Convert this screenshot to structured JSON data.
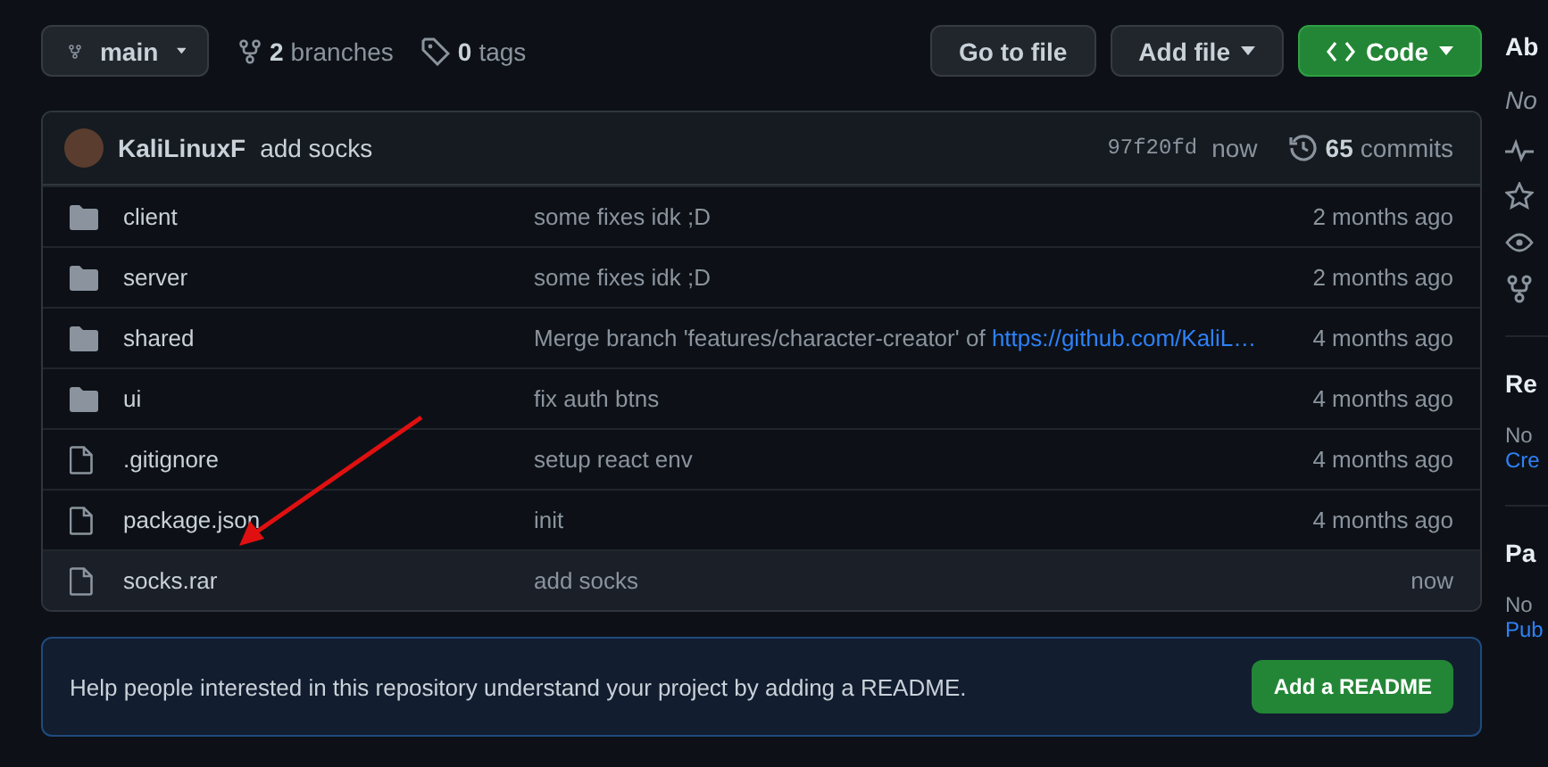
{
  "toolbar": {
    "branch": "main",
    "branches": {
      "count": "2",
      "label": "branches"
    },
    "tags": {
      "count": "0",
      "label": "tags"
    },
    "buttons": [
      {
        "label": "Go to file",
        "kind": "plain",
        "dropdown": false
      },
      {
        "label": "Add file",
        "kind": "plain",
        "dropdown": true
      },
      {
        "label": "Code",
        "kind": "primary",
        "dropdown": true
      }
    ]
  },
  "latest_commit": {
    "author": "KaliLinuxF",
    "message": "add socks",
    "sha": "97f20fd",
    "time": "now",
    "commits": {
      "count": "65",
      "label": "commits"
    }
  },
  "files": [
    {
      "kind": "folder",
      "name": "client",
      "message": "some fixes idk ;D",
      "time": "2 months ago",
      "highlighted": false
    },
    {
      "kind": "folder",
      "name": "server",
      "message": "some fixes idk ;D",
      "time": "2 months ago",
      "highlighted": false
    },
    {
      "kind": "folder",
      "name": "shared",
      "message": "Merge branch 'features/character-creator' of",
      "link": "https://github.com/KaliL…",
      "time": "4 months ago",
      "highlighted": false
    },
    {
      "kind": "folder",
      "name": "ui",
      "message": "fix auth btns",
      "time": "4 months ago",
      "highlighted": false
    },
    {
      "kind": "file",
      "name": ".gitignore",
      "message": "setup react env",
      "time": "4 months ago",
      "highlighted": false
    },
    {
      "kind": "file",
      "name": "package.json",
      "message": "init",
      "time": "4 months ago",
      "highlighted": false
    },
    {
      "kind": "file",
      "name": "socks.rar",
      "message": "add socks",
      "time": "now",
      "highlighted": true
    }
  ],
  "readme_banner": {
    "text": "Help people interested in this repository understand your project by adding a README.",
    "button": "Add a README"
  },
  "sidebar": {
    "about": {
      "title": "Ab",
      "description": "No"
    },
    "releases": {
      "title": "Re",
      "text": "No",
      "link": "Cre"
    },
    "packages": {
      "title": "Pa",
      "text": "No",
      "link": "Pub"
    }
  }
}
